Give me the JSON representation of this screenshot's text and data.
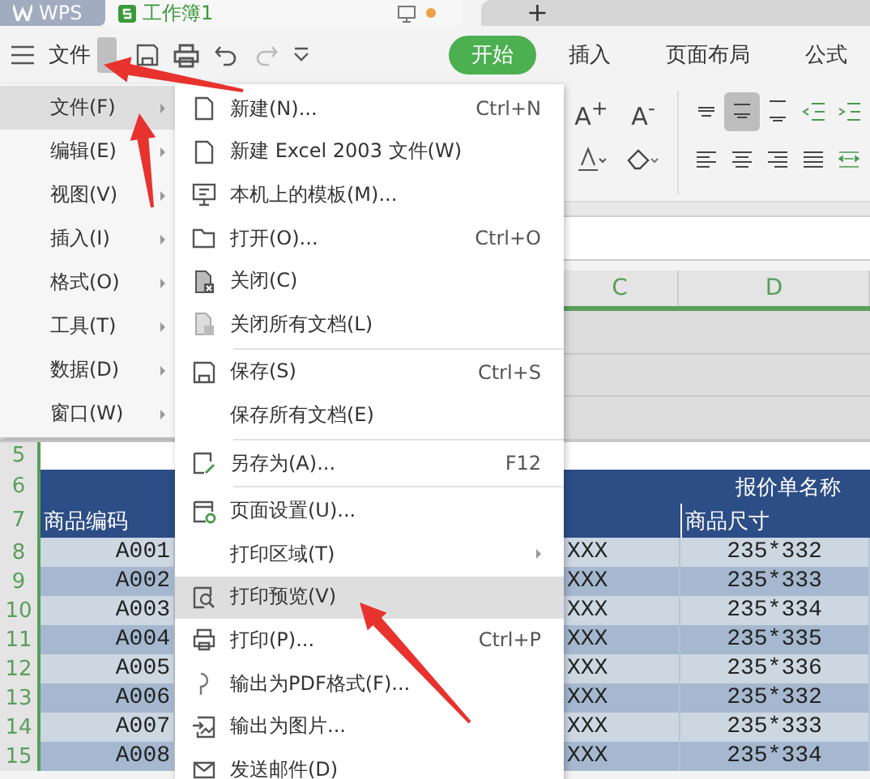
{
  "title_bar": {
    "tabs": [
      {
        "label": "WPS",
        "selected": false
      },
      {
        "label": "工作簿1",
        "selected": true
      }
    ],
    "new_tab": "+"
  },
  "toolbar": {
    "file_menu": "文件",
    "ribbon_tabs": [
      {
        "label": "开始",
        "selected": true
      },
      {
        "label": "插入",
        "selected": false
      },
      {
        "label": "页面布局",
        "selected": false
      },
      {
        "label": "公式",
        "selected": false
      }
    ]
  },
  "ribbon": {
    "font_size_buttons": [
      "A$^{+}$",
      "A$^{-}$"
    ],
    "vertical_align": [
      {
        "selected": false
      },
      {
        "selected": true
      },
      {
        "selected": false
      }
    ]
  },
  "column_headers": [
    "C",
    "D"
  ],
  "sheet": {
    "rows": [
      {
        "number": "5",
        "kind": "blank"
      },
      {
        "number": "6",
        "kind": "title",
        "title": "报价单名称"
      },
      {
        "number": "7",
        "kind": "header",
        "code": "商品编码",
        "size": "商品尺寸"
      },
      {
        "number": "8",
        "kind": "data",
        "code": "A001",
        "column_c": "XXX",
        "size": "235*332"
      },
      {
        "number": "9",
        "kind": "data",
        "code": "A002",
        "column_c": "XXX",
        "size": "235*333"
      },
      {
        "number": "10",
        "kind": "data",
        "code": "A003",
        "column_c": "XXX",
        "size": "235*334"
      },
      {
        "number": "11",
        "kind": "data",
        "code": "A004",
        "column_c": "XXX",
        "size": "235*335"
      },
      {
        "number": "12",
        "kind": "data",
        "code": "A005",
        "column_c": "XXX",
        "size": "235*336"
      },
      {
        "number": "13",
        "kind": "data",
        "code": "A006",
        "column_c": "XXX",
        "size": "235*332"
      },
      {
        "number": "14",
        "kind": "data",
        "code": "A007",
        "column_c": "XXX",
        "size": "235*333"
      },
      {
        "number": "15",
        "kind": "data",
        "code": "A008",
        "column_c": "XXX",
        "size": "235*334"
      }
    ]
  },
  "menu": {
    "items": [
      {
        "label": "文件(F)",
        "selected": true
      },
      {
        "label": "编辑(E)",
        "selected": false
      },
      {
        "label": "视图(V)",
        "selected": false
      },
      {
        "label": "插入(I)",
        "selected": false
      },
      {
        "label": "格式(O)",
        "selected": false
      },
      {
        "label": "工具(T)",
        "selected": false
      },
      {
        "label": "数据(D)",
        "selected": false
      },
      {
        "label": "窗口(W)",
        "selected": false
      }
    ]
  },
  "submenu": {
    "items": [
      {
        "kind": "item",
        "label": "新建(N)...",
        "shortcut": "Ctrl+N",
        "has_submenu": false,
        "selected": false
      },
      {
        "kind": "item",
        "label": "新建 Excel 2003 文件(W)",
        "has_submenu": false,
        "selected": false
      },
      {
        "kind": "item",
        "label": "本机上的模板(M)...",
        "has_submenu": false,
        "selected": false
      },
      {
        "kind": "item",
        "label": "打开(O)...",
        "shortcut": "Ctrl+O",
        "has_submenu": false,
        "selected": false
      },
      {
        "kind": "item",
        "label": "关闭(C)",
        "has_submenu": false,
        "selected": false
      },
      {
        "kind": "item",
        "label": "关闭所有文档(L)",
        "has_submenu": false,
        "selected": false
      },
      {
        "kind": "divider"
      },
      {
        "kind": "item",
        "label": "保存(S)",
        "shortcut": "Ctrl+S",
        "has_submenu": false,
        "selected": false
      },
      {
        "kind": "item",
        "label": "保存所有文档(E)",
        "has_submenu": false,
        "selected": false
      },
      {
        "kind": "divider"
      },
      {
        "kind": "item",
        "label": "另存为(A)...",
        "shortcut": "F12",
        "has_submenu": false,
        "selected": false
      },
      {
        "kind": "divider"
      },
      {
        "kind": "item",
        "label": "页面设置(U)...",
        "has_submenu": false,
        "selected": false
      },
      {
        "kind": "item",
        "label": "打印区域(T)",
        "has_submenu": true,
        "selected": false
      },
      {
        "kind": "item",
        "label": "打印预览(V)",
        "has_submenu": false,
        "selected": true
      },
      {
        "kind": "item",
        "label": "打印(P)...",
        "shortcut": "Ctrl+P",
        "has_submenu": false,
        "selected": false
      },
      {
        "kind": "item",
        "label": "输出为PDF格式(F)...",
        "has_submenu": false,
        "selected": false
      },
      {
        "kind": "item",
        "label": "输出为图片...",
        "has_submenu": false,
        "selected": false
      },
      {
        "kind": "item",
        "label": "发送邮件(D)",
        "has_submenu": false,
        "selected": false
      }
    ]
  }
}
